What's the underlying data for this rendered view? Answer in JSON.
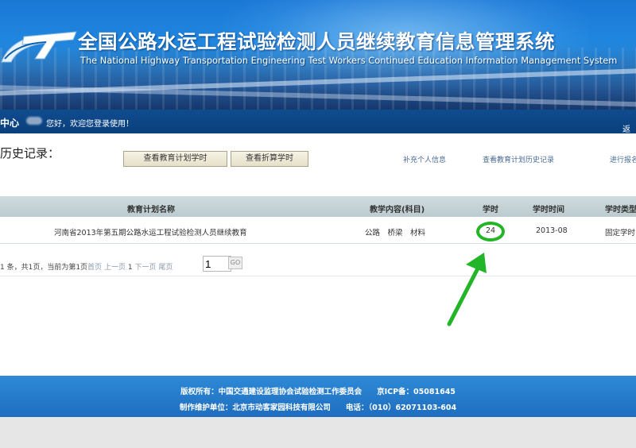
{
  "header": {
    "title_cn": "全国公路水运工程试验检测人员继续教育信息管理系统",
    "title_en": "The National Highway Transportation Engineering Test Workers Continued Education Information Management System"
  },
  "navbar": {
    "center_label": "中心",
    "greeting": "您好，欢迎您登录使用！",
    "back_link": "返回"
  },
  "page": {
    "history_title": "历史记录："
  },
  "toolbar": {
    "btn_view_plan_hours": "查看教育计划学时",
    "btn_view_converted_hours": "查看折算学时",
    "link_supplement_info": "补充个人信息",
    "link_view_plan_history": "查看教育计划历史记录",
    "link_proceed": "进行报名"
  },
  "table": {
    "headers": [
      "教育计划名称",
      "教学内容(科目)",
      "学时",
      "学时时间",
      "学时类型"
    ],
    "rows": [
      {
        "plan_name": "河南省2013年第五期公路水运工程试验检测人员继续教育",
        "subjects": "公路　桥梁　材料",
        "hours": "24",
        "period": "2013-08",
        "type": "固定学时"
      }
    ]
  },
  "pager": {
    "summary": "1 条，共1页，当前为第1页",
    "first": "首页",
    "prev": "上一页",
    "current": "1",
    "next": "下一页",
    "last": "尾页",
    "go": "GO"
  },
  "footer": {
    "line1": "版权所有：中国交通建设监理协会试验检测工作委员会　　京ICP备：05081645",
    "line2": "制作维护单位：北京市动客家园科技有限公司　　电话：（010）62071103-604"
  },
  "colors": {
    "banner_blue": "#1f85de",
    "nav_dark_blue": "#0a3f7c",
    "table_header": "#c8d6d9",
    "annotation_green": "#22b528",
    "footer_blue": "#2479c9"
  }
}
